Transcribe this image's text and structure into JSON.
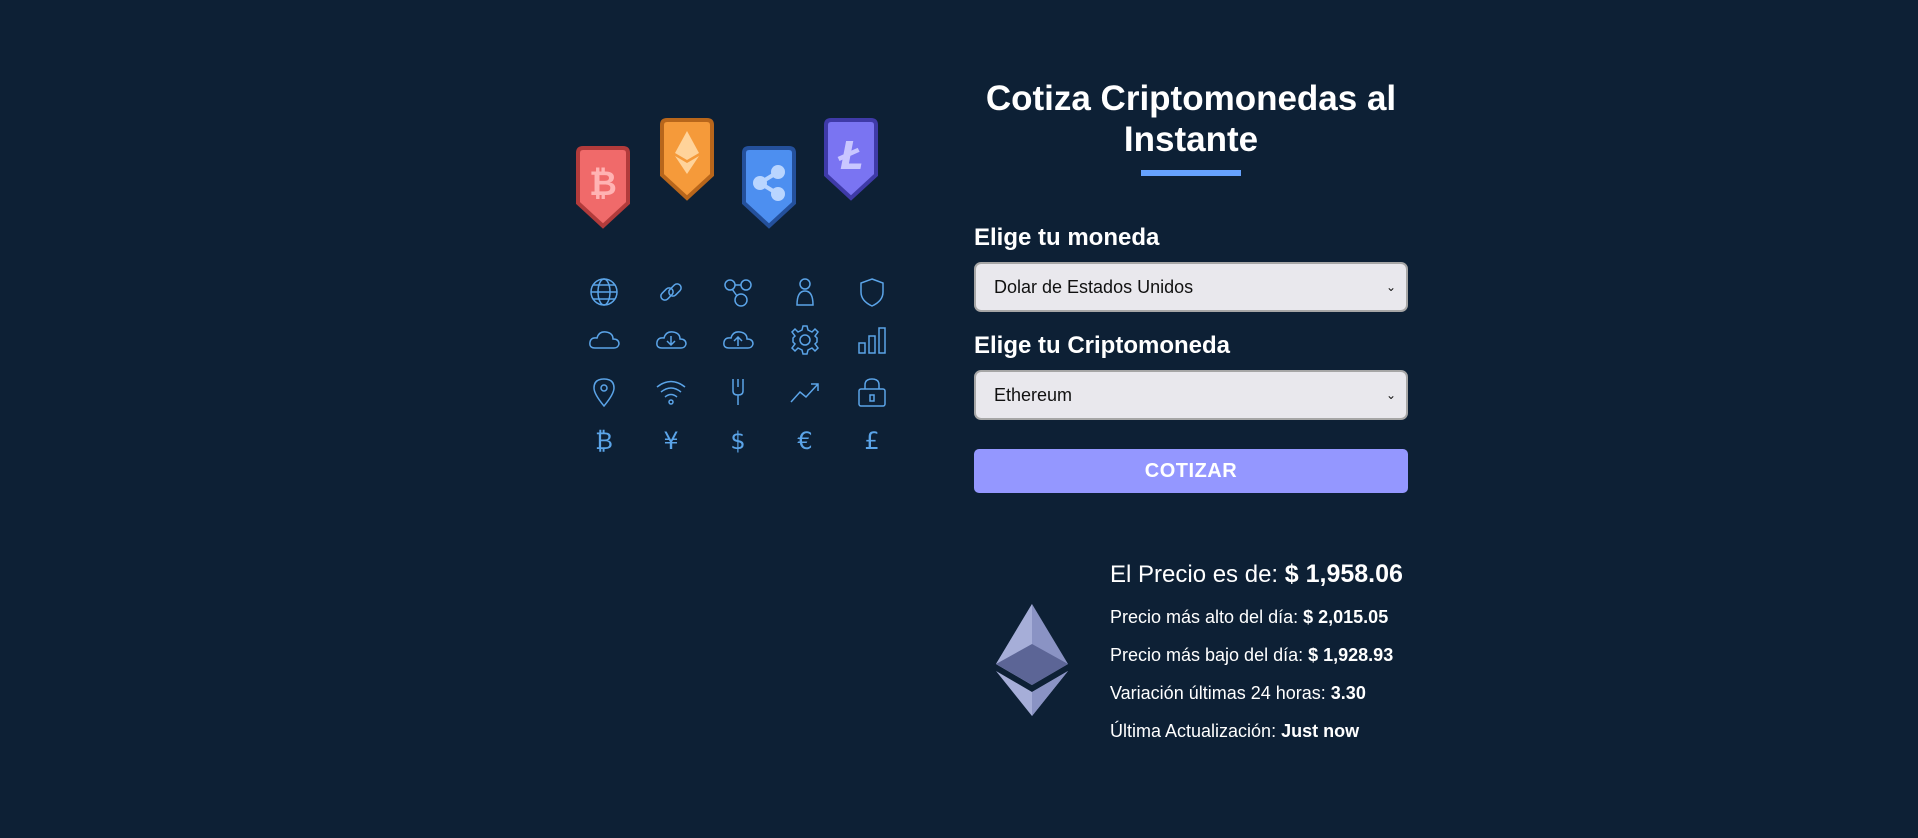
{
  "header": {
    "title_line1": "Cotiza Criptomonedas al",
    "title_line2": "Instante"
  },
  "form": {
    "currency_label": "Elige tu moneda",
    "currency_selected": "Dolar de Estados Unidos",
    "crypto_label": "Elige tu Criptomoneda",
    "crypto_selected": "Ethereum",
    "submit_label": "COTIZAR"
  },
  "result": {
    "price_label": "El Precio es de:",
    "price_value": "$ 1,958.06",
    "high_label": "Precio más alto del día:",
    "high_value": "$ 2,015.05",
    "low_label": "Precio más bajo del día:",
    "low_value": "$ 1,928.93",
    "change_label": "Variación últimas 24 horas:",
    "change_value": "3.30",
    "updated_label": "Última Actualización:",
    "updated_value": "Just now"
  },
  "illustration": {
    "badges": [
      "bitcoin-badge-icon",
      "ethereum-badge-icon",
      "ripple-badge-icon",
      "litecoin-badge-icon"
    ],
    "icons": [
      "globe-icon",
      "link-icon",
      "network-icon",
      "user-icon",
      "shield-icon",
      "cloud-icon",
      "cloud-download-icon",
      "cloud-upload-icon",
      "gear-icon",
      "bar-chart-icon",
      "location-pin-icon",
      "wifi-icon",
      "fork-icon",
      "trend-up-icon",
      "lock-icon",
      "bitcoin-icon",
      "yen-icon",
      "dollar-icon",
      "euro-icon",
      "pound-icon"
    ]
  },
  "colors": {
    "background": "#0d2035",
    "accent": "#66a2fe",
    "button": "#9497ff",
    "icon_stroke": "#5ba4e8"
  }
}
